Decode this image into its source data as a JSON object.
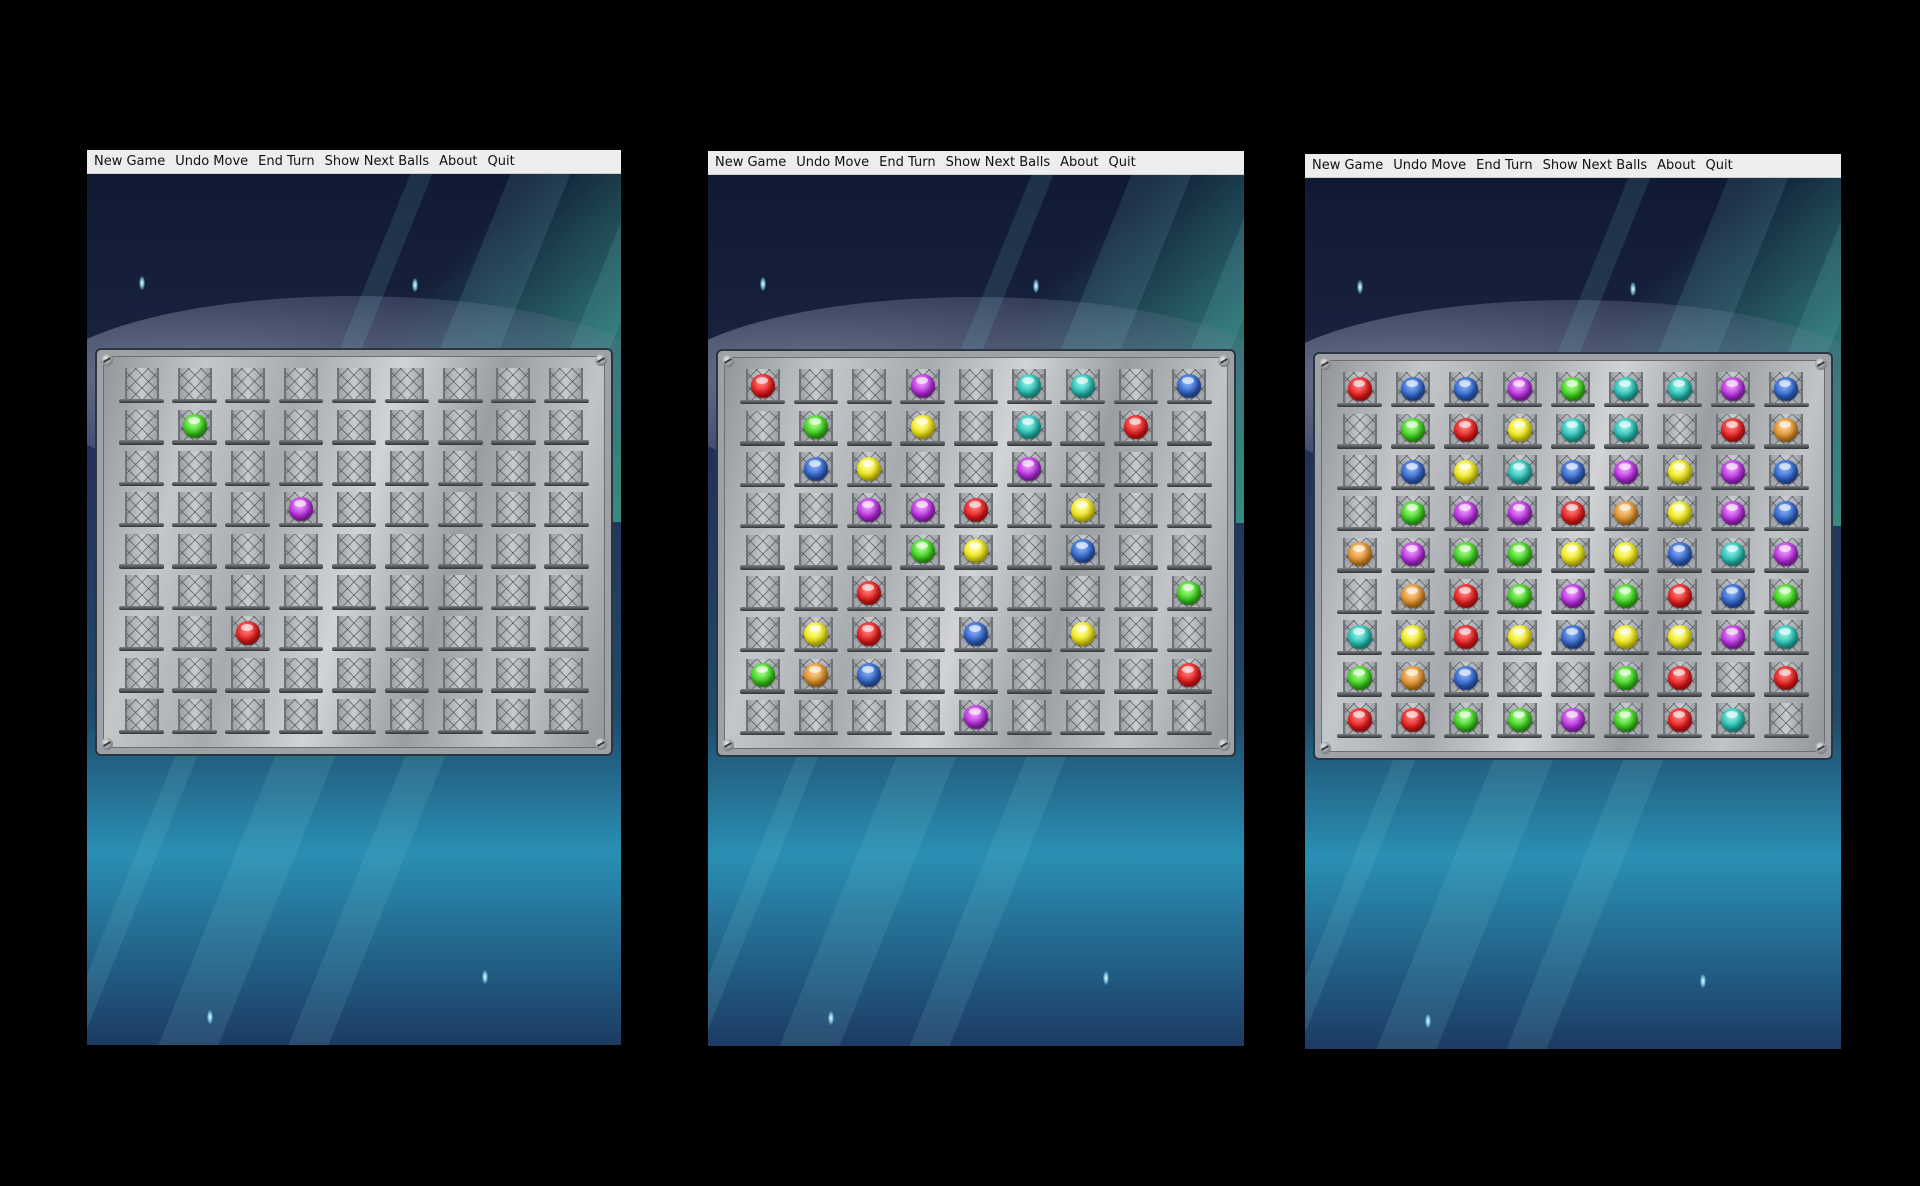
{
  "menu": [
    "New Game",
    "Undo Move",
    "End Turn",
    "Show Next Balls",
    "About",
    "Quit"
  ],
  "colors": {
    "red": "#e81a1a",
    "green": "#39d21a",
    "blue": "#2f63c9",
    "yellow": "#f2ea12",
    "purple": "#b72ae0",
    "cyan": "#25c0b4",
    "orange": "#e2922a"
  },
  "games": [
    {
      "board": [
        [
          ".",
          ".",
          ".",
          ".",
          ".",
          ".",
          ".",
          ".",
          "."
        ],
        [
          ".",
          "G",
          ".",
          ".",
          ".",
          ".",
          ".",
          ".",
          "."
        ],
        [
          ".",
          ".",
          ".",
          ".",
          ".",
          ".",
          ".",
          ".",
          "."
        ],
        [
          ".",
          ".",
          ".",
          "P",
          ".",
          ".",
          ".",
          ".",
          "."
        ],
        [
          ".",
          ".",
          ".",
          ".",
          ".",
          ".",
          ".",
          ".",
          "."
        ],
        [
          ".",
          ".",
          ".",
          ".",
          ".",
          ".",
          ".",
          ".",
          "."
        ],
        [
          ".",
          ".",
          "R",
          ".",
          ".",
          ".",
          ".",
          ".",
          "."
        ],
        [
          ".",
          ".",
          ".",
          ".",
          ".",
          ".",
          ".",
          ".",
          "."
        ],
        [
          ".",
          ".",
          ".",
          ".",
          ".",
          ".",
          ".",
          ".",
          "."
        ]
      ]
    },
    {
      "board": [
        [
          "R",
          ".",
          ".",
          "P",
          ".",
          "C",
          "C",
          ".",
          "B"
        ],
        [
          ".",
          "G",
          ".",
          "Y",
          ".",
          "C",
          ".",
          "R",
          "."
        ],
        [
          ".",
          "B",
          "Y",
          ".",
          ".",
          "P",
          ".",
          ".",
          "."
        ],
        [
          ".",
          ".",
          "P",
          "P",
          "R",
          ".",
          "Y",
          ".",
          "."
        ],
        [
          ".",
          ".",
          ".",
          "G",
          "Y",
          ".",
          "B",
          ".",
          "."
        ],
        [
          ".",
          ".",
          "R",
          ".",
          ".",
          ".",
          ".",
          ".",
          "G"
        ],
        [
          ".",
          "Y",
          "R",
          ".",
          "B",
          ".",
          "Y",
          ".",
          "."
        ],
        [
          "G",
          "O",
          "B",
          ".",
          ".",
          ".",
          ".",
          ".",
          "R"
        ],
        [
          ".",
          ".",
          ".",
          ".",
          "P",
          ".",
          ".",
          ".",
          "."
        ]
      ]
    },
    {
      "board": [
        [
          "R",
          "B",
          "B",
          "P",
          "G",
          "C",
          "C",
          "P",
          "B"
        ],
        [
          ".",
          "G",
          "R",
          "Y",
          "C",
          "C",
          ".",
          "R",
          "O"
        ],
        [
          ".",
          "B",
          "Y",
          "C",
          "B",
          "P",
          "Y",
          "P",
          "B"
        ],
        [
          ".",
          "G",
          "P",
          "P",
          "R",
          "O",
          "Y",
          "P",
          "B"
        ],
        [
          "O",
          "P",
          "G",
          "G",
          "Y",
          "Y",
          "B",
          "C",
          "P"
        ],
        [
          ".",
          "O",
          "R",
          "G",
          "P",
          "G",
          "R",
          "B",
          "G"
        ],
        [
          "C",
          "Y",
          "R",
          "Y",
          "B",
          "Y",
          "Y",
          "P",
          "C"
        ],
        [
          "G",
          "O",
          "B",
          ".",
          ".",
          "G",
          "R",
          ".",
          "R"
        ],
        [
          "R",
          "R",
          "G",
          "G",
          "P",
          "G",
          "R",
          "C",
          "."
        ]
      ]
    }
  ]
}
